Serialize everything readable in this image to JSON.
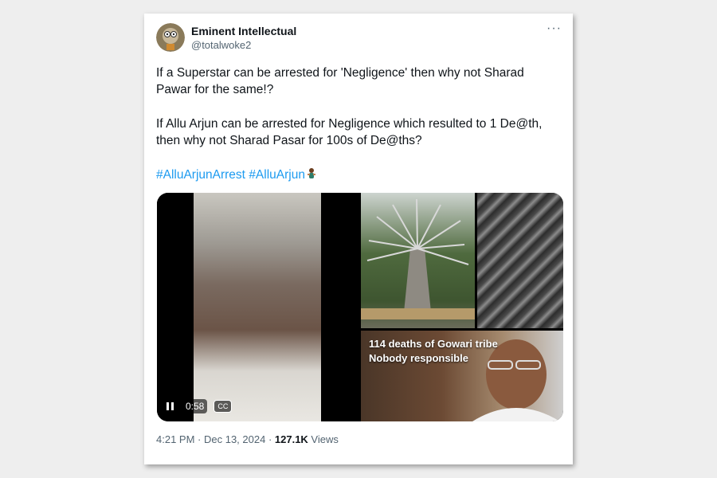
{
  "tweet": {
    "author_name": "Eminent Intellectual",
    "author_handle": "@totalwoke2",
    "more_icon": "more-dots-icon",
    "paragraph1": "If a Superstar can be arrested for 'Negligence' then why not Sharad Pawar for the same!?",
    "paragraph2": "If Allu Arjun can be arrested for Negligence which resulted to 1 De@th, then why not Sharad Pasar for 100s of De@ths?",
    "hashtags": [
      "#AlluArjunArrest",
      "#AlluArjun"
    ],
    "emoji": "man-dancing-emoji",
    "video": {
      "time": "0:58",
      "cc_label": "CC",
      "pause_icon": "pause-icon"
    },
    "image_overlay": {
      "line1": "114 deaths of Gowari tribe",
      "line2": "Nobody responsible"
    },
    "footer": {
      "time": "4:21 PM",
      "separator1": " · ",
      "date": "Dec 13, 2024",
      "separator2": " · ",
      "views_count": "127.1K",
      "views_label": " Views"
    }
  },
  "colors": {
    "link": "#1d9bf0",
    "text": "#0f1419",
    "muted": "#536471",
    "background": "#eeeeee"
  }
}
